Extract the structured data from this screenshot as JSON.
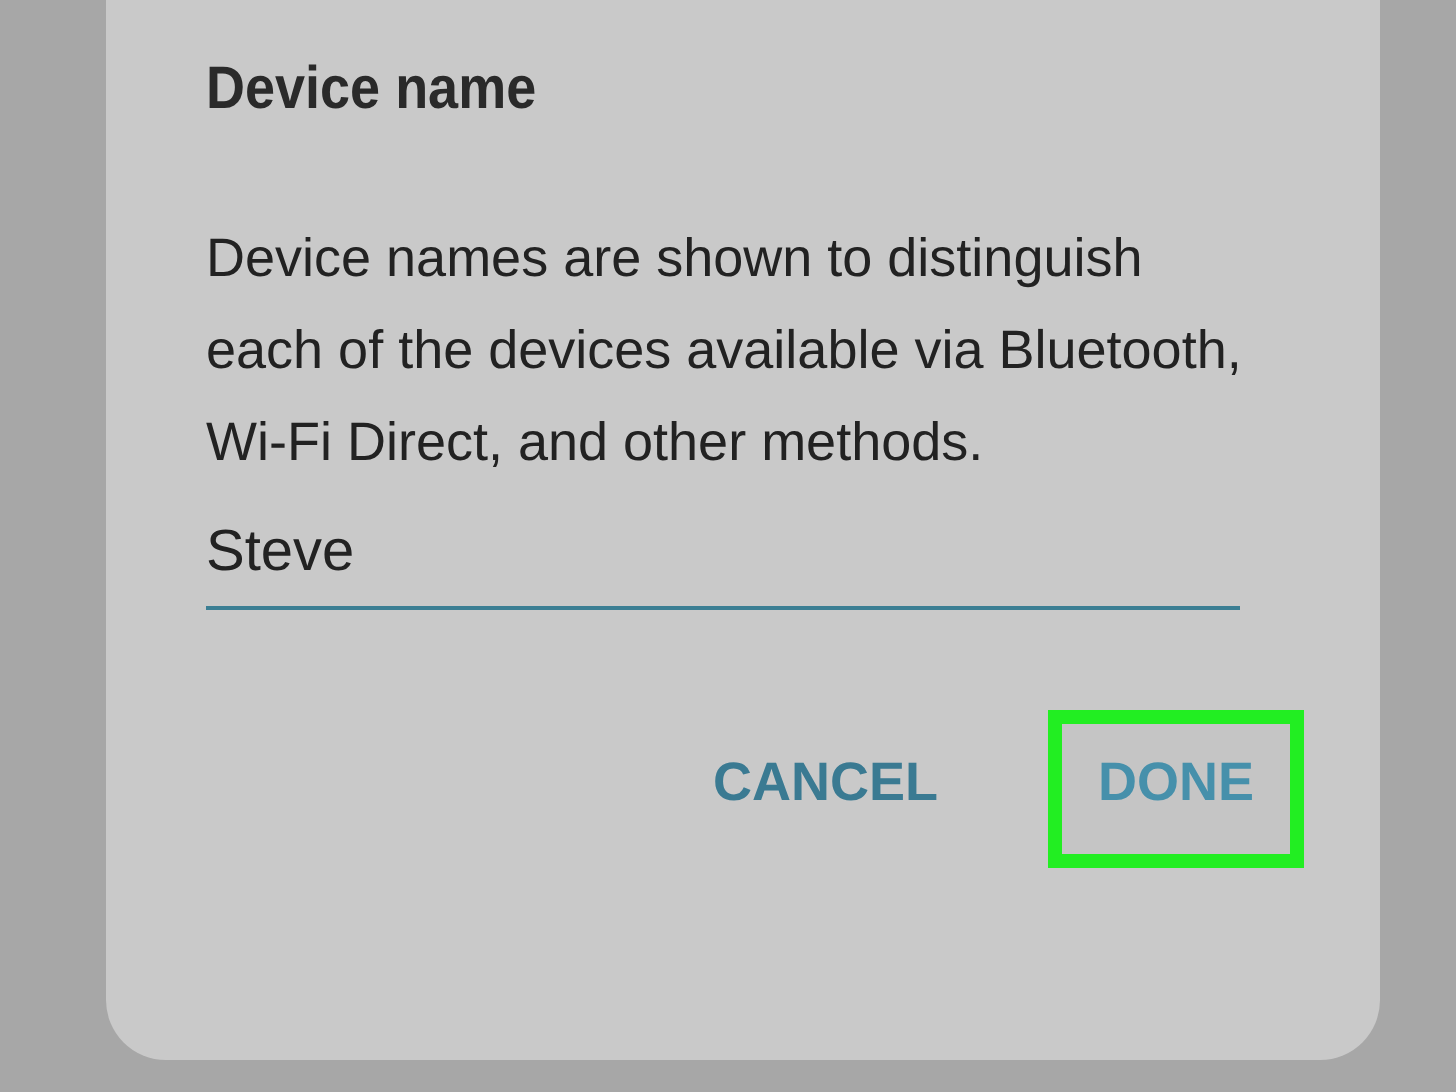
{
  "dialog": {
    "title": "Device name",
    "message": "Device names are shown to distinguish each of the devices available via Bluetooth, Wi-Fi Direct, and other methods.",
    "field": {
      "value": "Steve"
    }
  },
  "buttons": [
    {
      "label": "CANCEL",
      "highlighted": false
    },
    {
      "label": "DONE",
      "highlighted": true
    }
  ]
}
